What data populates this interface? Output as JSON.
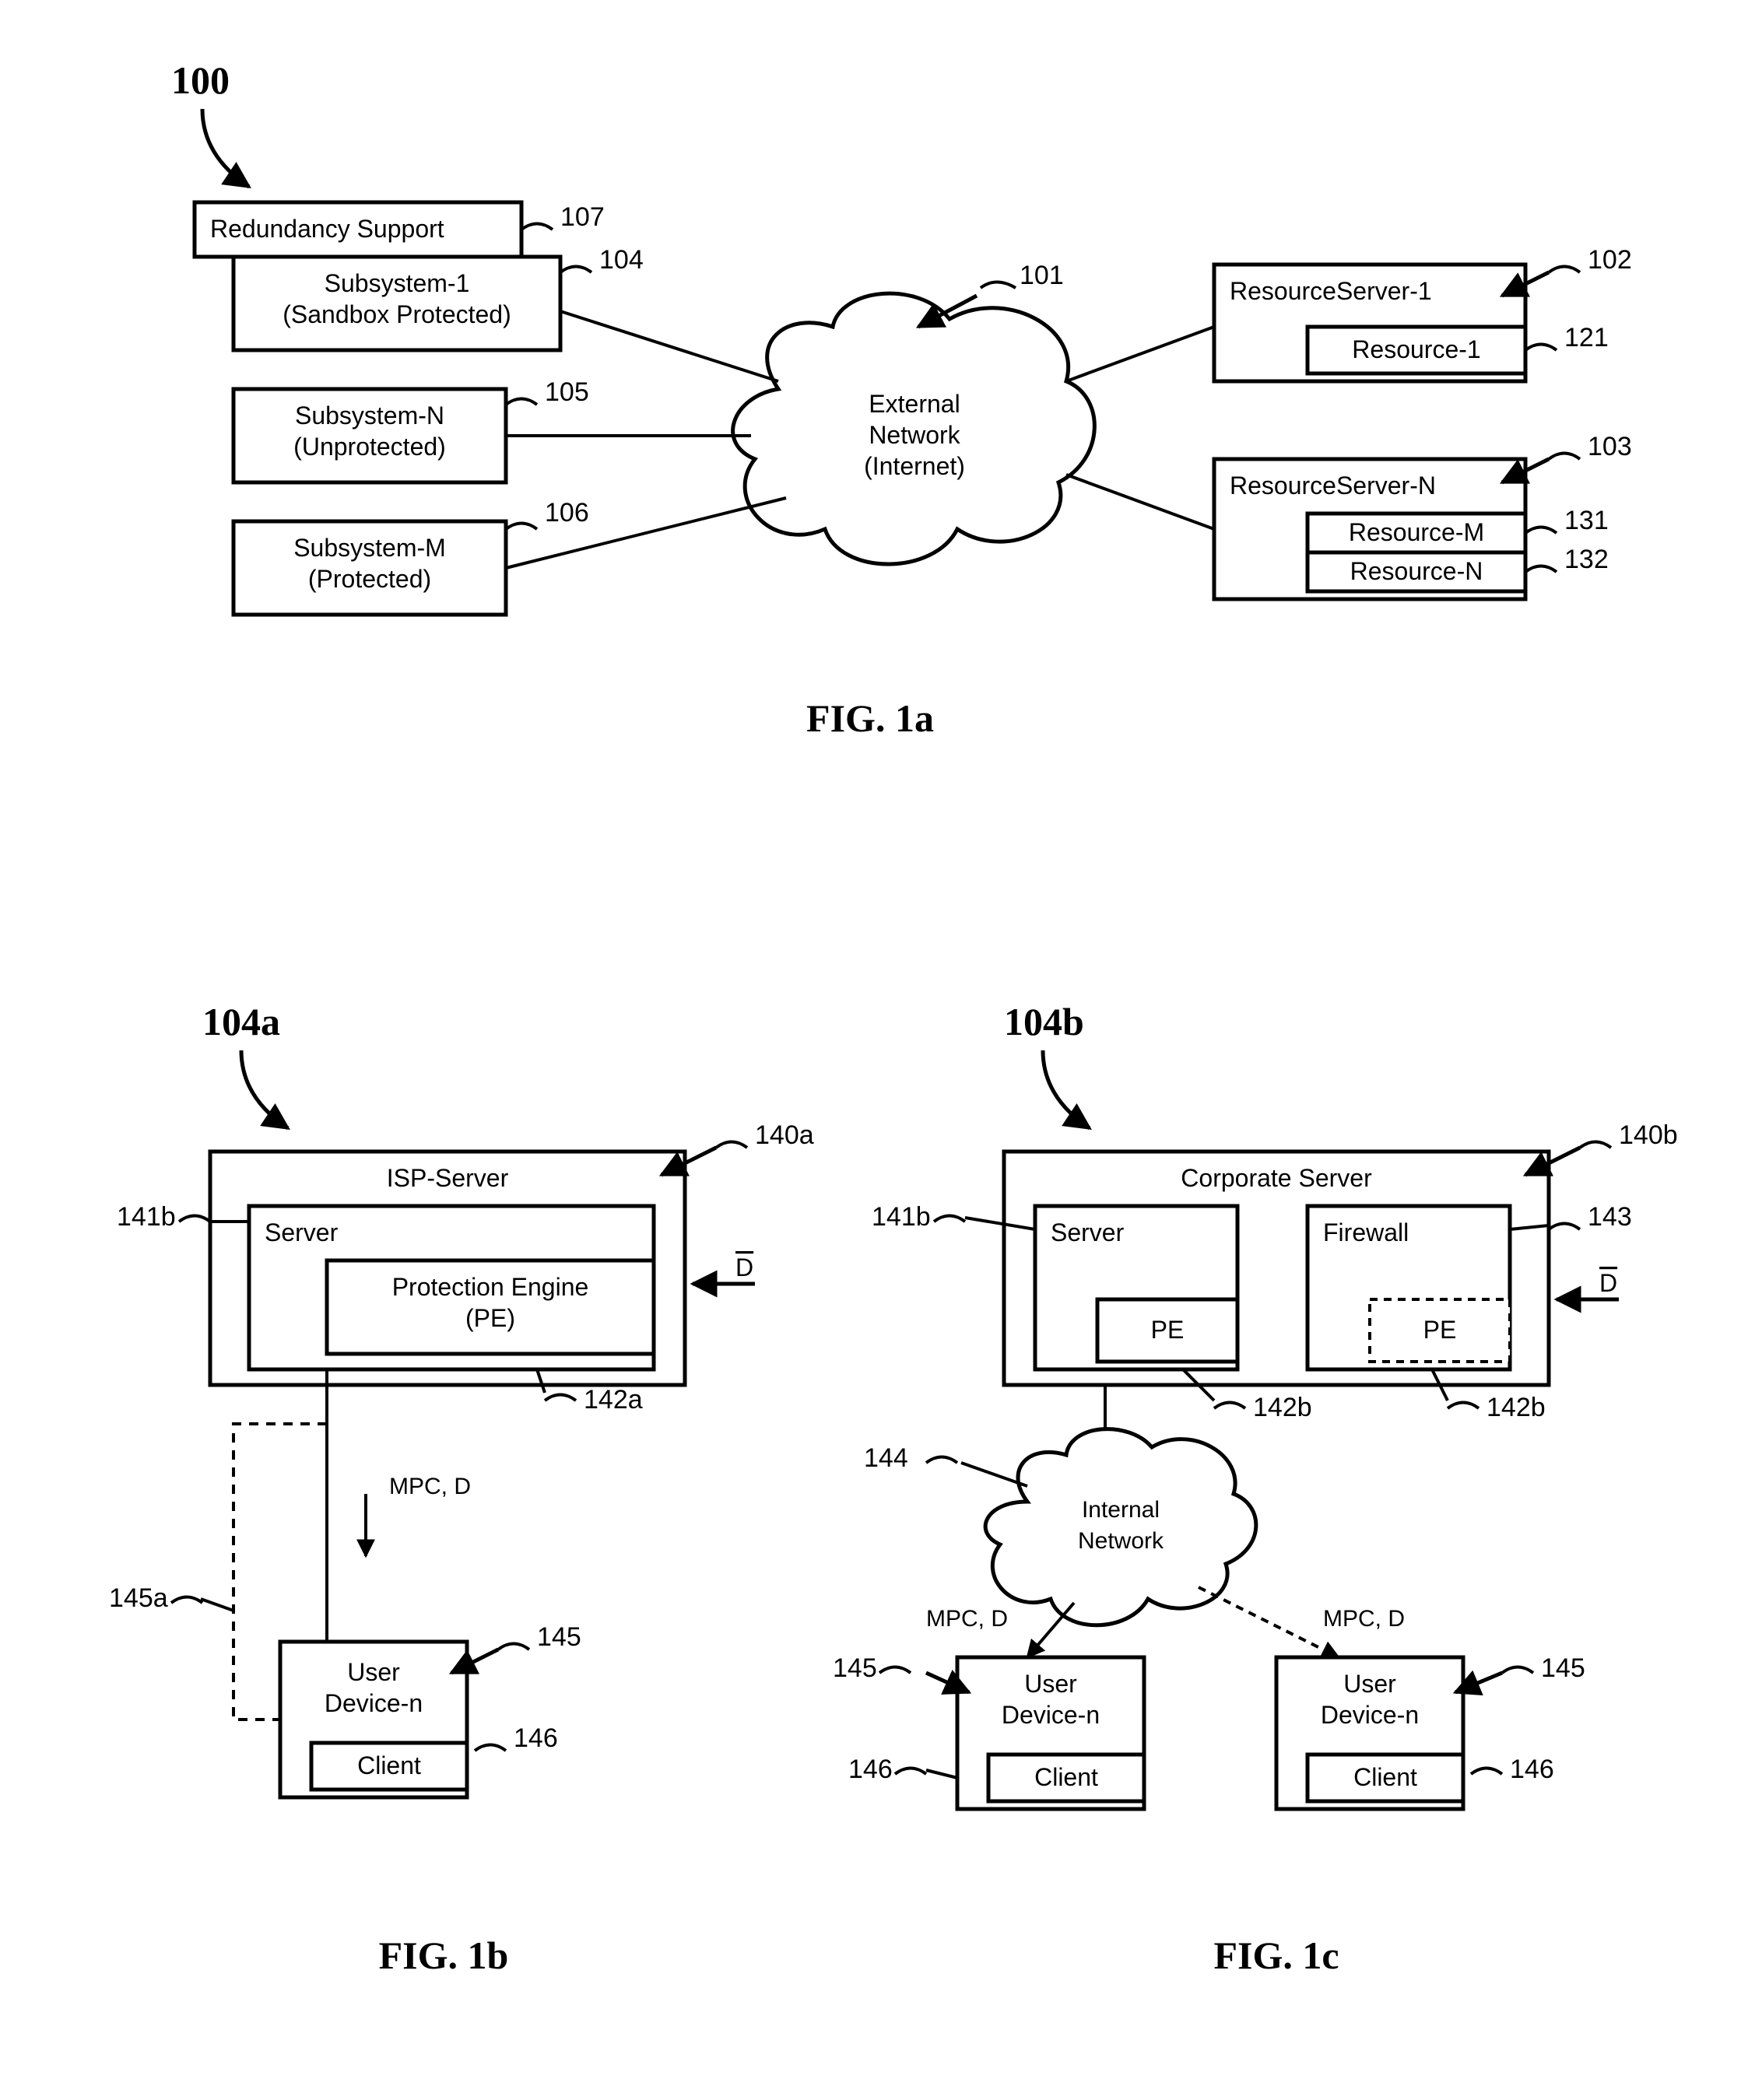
{
  "fig1a": {
    "sys_ref": "100",
    "redundancy": "Redundancy Support",
    "ref107": "107",
    "subsys1_l1": "Subsystem-1",
    "subsys1_l2": "(Sandbox Protected)",
    "ref104": "104",
    "subsysN_l1": "Subsystem-N",
    "subsysN_l2": "(Unprotected)",
    "ref105": "105",
    "subsysM_l1": "Subsystem-M",
    "subsysM_l2": "(Protected)",
    "ref106": "106",
    "cloud_l1": "External",
    "cloud_l2": "Network",
    "cloud_l3": "(Internet)",
    "ref101": "101",
    "rs1": "ResourceServer-1",
    "ref102": "102",
    "res1": "Resource-1",
    "ref121": "121",
    "rsN": "ResourceServer-N",
    "ref103": "103",
    "resM": "Resource-M",
    "ref131": "131",
    "resN": "Resource-N",
    "ref132": "132",
    "caption": "FIG. 1a"
  },
  "fig1b": {
    "sys_ref": "104a",
    "isp": "ISP-Server",
    "ref140a": "140a",
    "server": "Server",
    "ref141b": "141b",
    "pe_l1": "Protection Engine",
    "pe_l2": "(PE)",
    "ref142a": "142a",
    "D": "D",
    "mpc_d": "MPC, D",
    "user_l1": "User",
    "user_l2": "Device-n",
    "ref145": "145",
    "ref145a": "145a",
    "client": "Client",
    "ref146": "146",
    "caption": "FIG. 1b"
  },
  "fig1c": {
    "sys_ref": "104b",
    "corp": "Corporate Server",
    "ref140b": "140b",
    "server": "Server",
    "ref141b": "141b",
    "pe": "PE",
    "ref142b": "142b",
    "firewall": "Firewall",
    "ref143": "143",
    "internal_l1": "Internal",
    "internal_l2": "Network",
    "ref144": "144",
    "mpc_d": "MPC, D",
    "user_l1": "User",
    "user_l2": "Device-n",
    "ref145": "145",
    "client": "Client",
    "ref146": "146",
    "D": "D",
    "caption": "FIG. 1c"
  }
}
